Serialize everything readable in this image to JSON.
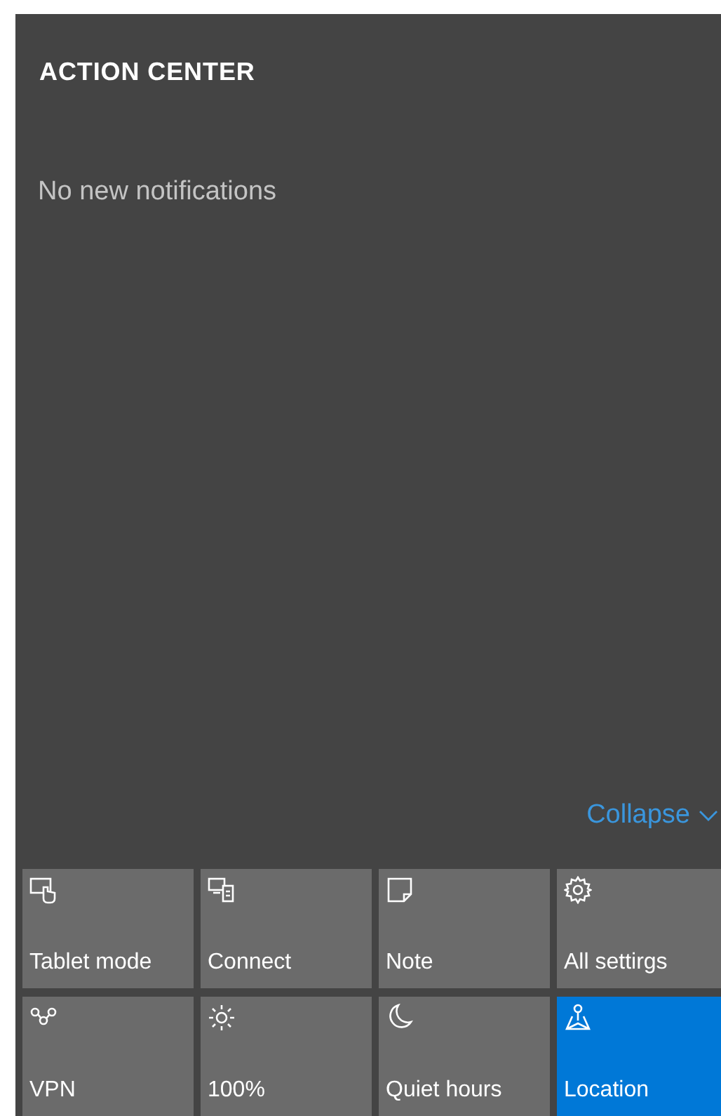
{
  "header": {
    "title": "ACTION CENTER"
  },
  "notifications": {
    "empty_message": "No new notifications"
  },
  "collapse": {
    "label": "Collapse"
  },
  "quick_actions": [
    {
      "kind": "tablet",
      "label": "Tablet mode",
      "selected": false
    },
    {
      "kind": "connect",
      "label": "Connect",
      "selected": false
    },
    {
      "kind": "note",
      "label": "Note",
      "selected": false
    },
    {
      "kind": "settings",
      "label": "All settirgs",
      "selected": false
    },
    {
      "kind": "vpn",
      "label": "VPN",
      "selected": false
    },
    {
      "kind": "brightness",
      "label": "100%",
      "selected": false
    },
    {
      "kind": "moon",
      "label": "Quiet hours",
      "selected": false
    },
    {
      "kind": "location",
      "label": "Location",
      "selected": true
    }
  ]
}
